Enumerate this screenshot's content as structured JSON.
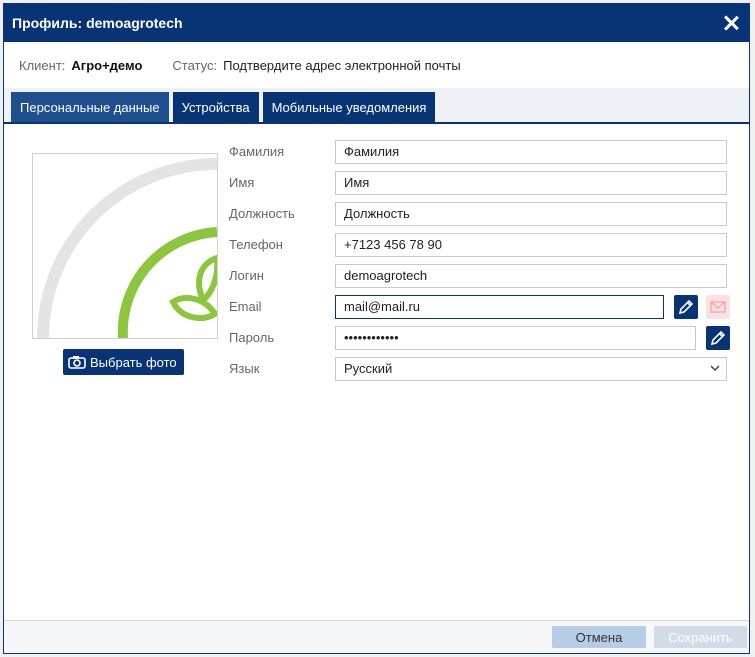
{
  "title": "Профиль: demoagrotech",
  "info": {
    "client_label": "Клиент:",
    "client_value": "Агро+демо",
    "status_label": "Статус:",
    "status_value": "Подтвердите адрес электронной почты"
  },
  "tabs": [
    {
      "label": "Персональные данные"
    },
    {
      "label": "Устройства"
    },
    {
      "label": "Мобильные уведомления"
    }
  ],
  "photo_button_label": "Выбрать фото",
  "fields": {
    "lastname": {
      "label": "Фамилия",
      "value": "Фамилия"
    },
    "firstname": {
      "label": "Имя",
      "value": "Имя"
    },
    "position": {
      "label": "Должность",
      "value": "Должность"
    },
    "phone": {
      "label": "Телефон",
      "value": "+7123 456 78 90"
    },
    "login": {
      "label": "Логин",
      "value": "demoagrotech"
    },
    "email": {
      "label": "Email",
      "value": "mail@mail.ru"
    },
    "password": {
      "label": "Пароль",
      "value": "••••••••••••"
    },
    "language": {
      "label": "Язык",
      "value": "Русский"
    }
  },
  "footer": {
    "cancel_label": "Отмена",
    "save_label": "Сохранить"
  },
  "colors": {
    "primary": "#083475",
    "tab_active": "#1f4f8e",
    "logo_green": "#8cc63f",
    "cancel_bg": "#b6cde8",
    "save_disabled_bg": "#d2dbe6",
    "mail_disabled_bg": "#fbe1e1"
  }
}
